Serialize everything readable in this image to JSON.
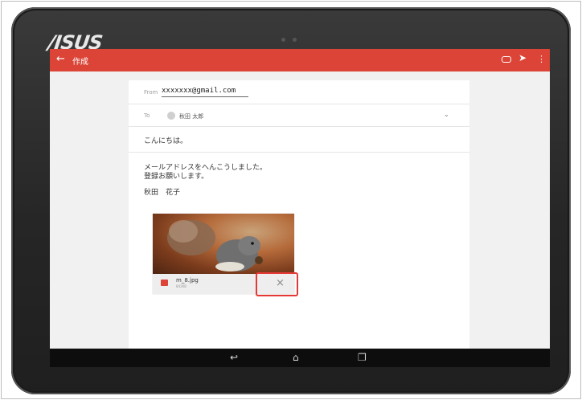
{
  "device": {
    "brand_logo": "/ISUS"
  },
  "app": {
    "back_icon": "arrow-left-icon",
    "title": "作成",
    "toolbar_icons": [
      "attach-icon",
      "send-icon",
      "more-vert-icon"
    ]
  },
  "compose": {
    "from_label": "From",
    "from_value": "xxxxxxx@gmail.com",
    "to_label": "To",
    "to_recipient": "秋田 太郎",
    "subject": "こんにちは。",
    "body_line1": "メールアドレスをへんこうしました。",
    "body_line2": "登録お願いします。",
    "signature": "秋田　花子"
  },
  "attachment": {
    "file_name": "m_8.jpg",
    "file_size": "842KB",
    "remove_symbol": "×"
  },
  "nav": {
    "back_symbol": "↩",
    "home_symbol": "⌂",
    "recents_symbol": "❐"
  },
  "colors": {
    "accent": "#db4437",
    "highlight": "#e53935"
  }
}
